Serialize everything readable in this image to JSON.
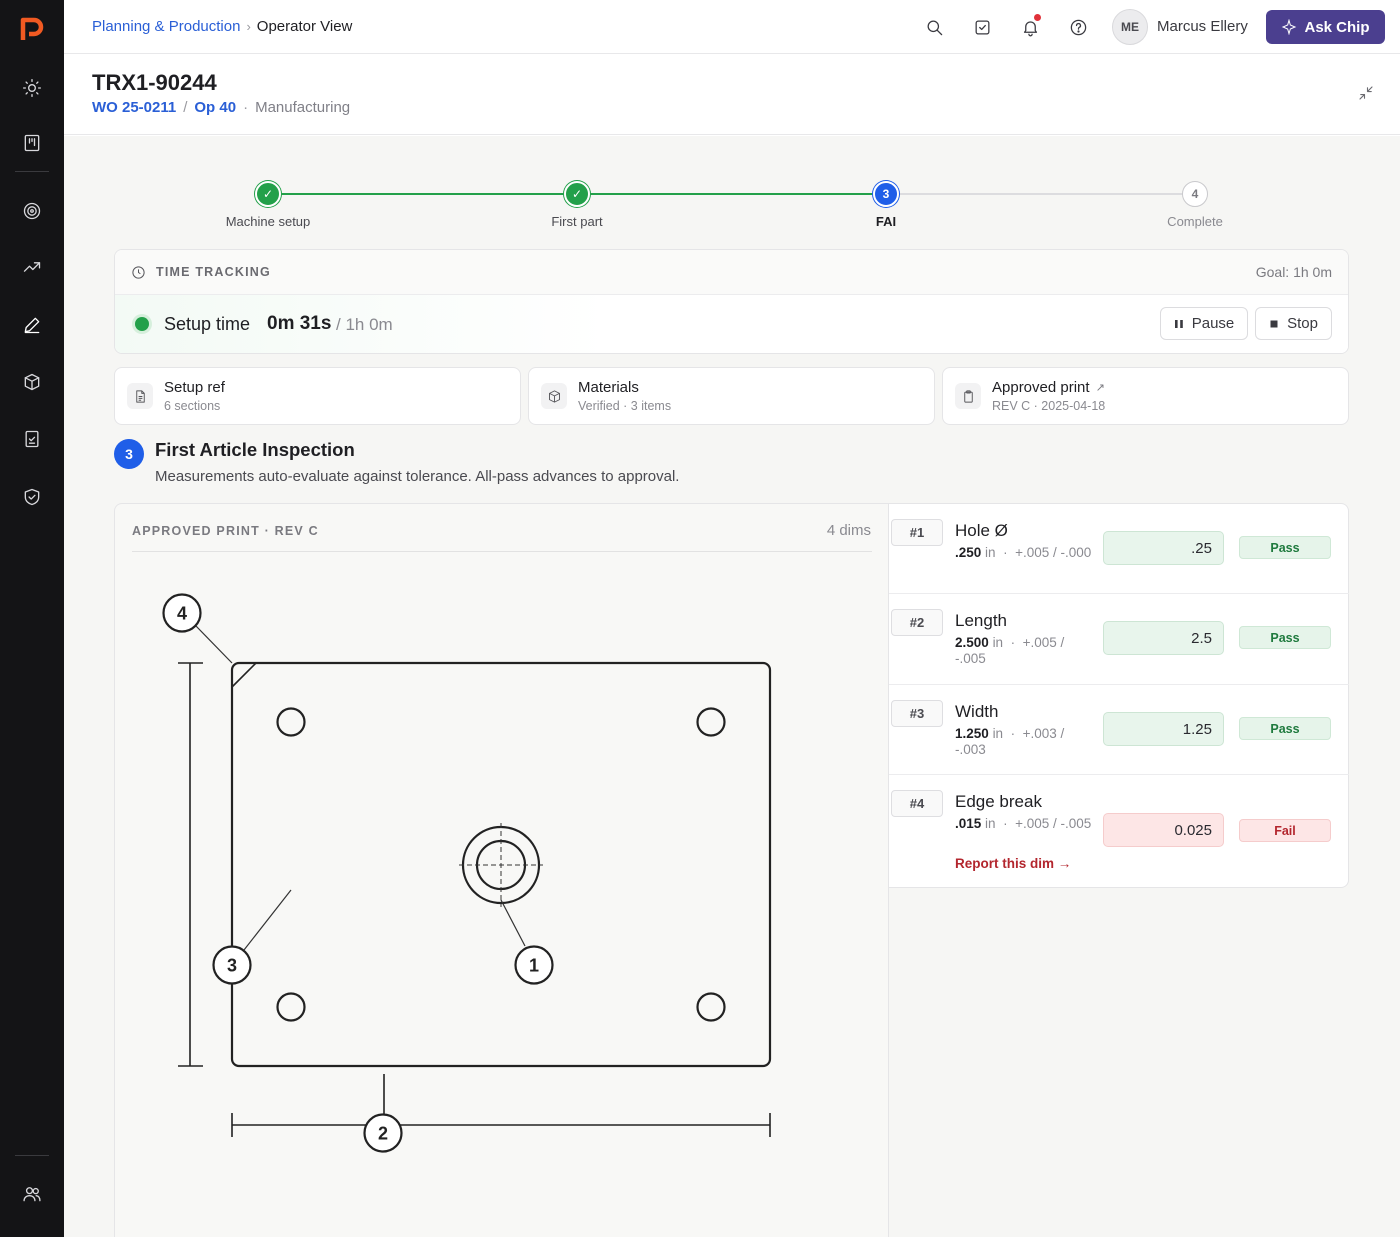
{
  "nav": {
    "icons": [
      "sun-icon",
      "kanban-icon",
      "target-icon",
      "trend-icon",
      "pen-icon",
      "box-icon",
      "checklist-icon",
      "shield-check-icon",
      "users-icon"
    ]
  },
  "topbar": {
    "breadcrumb_parent": "Planning & Production",
    "breadcrumb_sep": "›",
    "breadcrumb_current": "Operator View",
    "avatar_initials": "ME",
    "user_name": "Marcus Ellery",
    "ask_label": "Ask Chip"
  },
  "header": {
    "title": "TRX1-90244",
    "work_order": "WO 25-0211",
    "slash": "/",
    "operation": "Op 40",
    "dot": "·",
    "department": "Manufacturing"
  },
  "steps": [
    {
      "num": "1",
      "label": "Machine setup",
      "state": "done"
    },
    {
      "num": "2",
      "label": "First part",
      "state": "done"
    },
    {
      "num": "3",
      "label": "FAI",
      "state": "active"
    },
    {
      "num": "4",
      "label": "Complete",
      "state": "todo"
    }
  ],
  "time_tracking": {
    "label": "TIME TRACKING",
    "goal": "Goal: 1h 0m",
    "timer_label": "Setup time",
    "elapsed": "0m 31s",
    "total": "/ 1h 0m",
    "pause_label": "Pause",
    "stop_label": "Stop"
  },
  "info_cards": [
    {
      "title": "Setup ref",
      "sub": "6 sections",
      "icon": "document-icon"
    },
    {
      "title": "Materials",
      "sub": "Verified · 3 items",
      "icon": "box-icon"
    },
    {
      "title": "Approved print",
      "sub": "REV C · 2025-04-18",
      "icon": "clipboard-icon",
      "ext": "↗"
    }
  ],
  "fai": {
    "number": "3",
    "title": "First Article Inspection",
    "description": "Measurements auto-evaluate against tolerance. All-pass advances to approval."
  },
  "print": {
    "header": "APPROVED PRINT · REV C",
    "dims_count": "4 dims",
    "callouts": [
      "1",
      "2",
      "3",
      "4"
    ]
  },
  "dimensions": [
    {
      "num": "#1",
      "name": "Hole Ø",
      "nominal": ".250",
      "unit": "in",
      "sep": "·",
      "tol": "+.005 / -.000",
      "measured": ".25",
      "status": "Pass",
      "state": "pass"
    },
    {
      "num": "#2",
      "name": "Length",
      "nominal": "2.500",
      "unit": "in",
      "sep": "·",
      "tol": "+.005 / -.005",
      "measured": "2.5",
      "status": "Pass",
      "state": "pass"
    },
    {
      "num": "#3",
      "name": "Width",
      "nominal": "1.250",
      "unit": "in",
      "sep": "·",
      "tol": "+.003 / -.003",
      "measured": "1.25",
      "status": "Pass",
      "state": "pass"
    },
    {
      "num": "#4",
      "name": "Edge break",
      "nominal": ".015",
      "unit": "in",
      "sep": "·",
      "tol": "+.005 / -.005",
      "measured": "0.025",
      "status": "Fail",
      "state": "fail",
      "report": "Report this dim →"
    }
  ],
  "colors": {
    "accent": "#1f5ee8",
    "success": "#23a04a",
    "danger": "#b3262e",
    "chip": "#4b3f8f",
    "sidebar": "#141416"
  }
}
